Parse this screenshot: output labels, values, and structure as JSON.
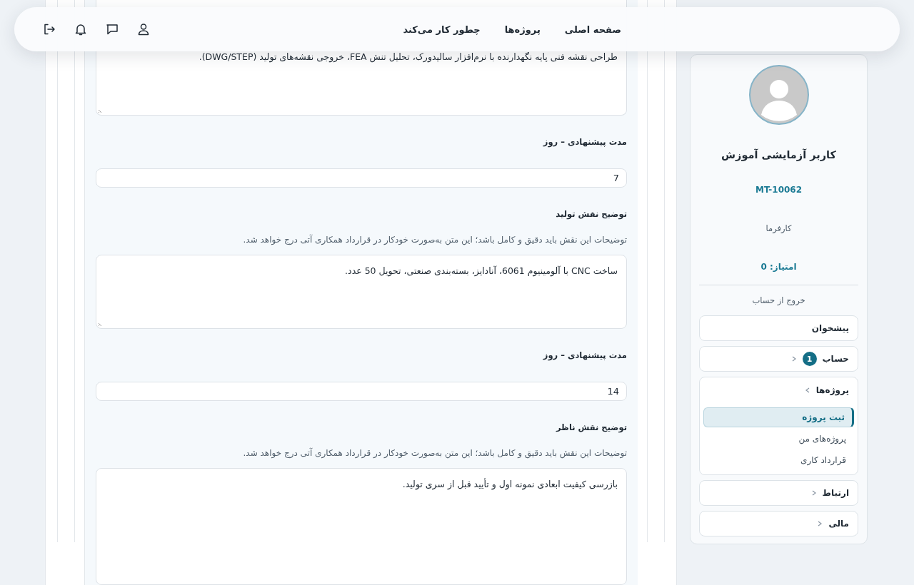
{
  "nav": {
    "links": [
      {
        "label": "صفحه اصلی"
      },
      {
        "label": "پروژه‌ها"
      },
      {
        "label": "چطور کار می‌کند"
      }
    ]
  },
  "form": [
    {
      "kind": "textarea",
      "value": "طراحی نقشه فنی پایه نگهدارنده با نرم‌افزار سالیدورک، تحلیل تنش FEA، خروجی نقشه‌های تولید (DWG/STEP)."
    },
    {
      "kind": "label",
      "text": "مدت پیشنهادی – روز"
    },
    {
      "kind": "input",
      "value": "7"
    },
    {
      "kind": "label",
      "text": "توضیح نقش تولید"
    },
    {
      "kind": "hint",
      "text": "توضیحات این نقش باید دقیق و کامل باشد؛ این متن به‌صورت خودکار در قرارداد همکاری آتی درج خواهد شد."
    },
    {
      "kind": "textarea",
      "value": "ساخت CNC با آلومینیوم 6061، آنادایز، بسته‌بندی صنعتی، تحویل 50 عدد."
    },
    {
      "kind": "label",
      "text": "مدت پیشنهادی – روز"
    },
    {
      "kind": "input",
      "value": "14"
    },
    {
      "kind": "label",
      "text": "توضیح نقش ناظر"
    },
    {
      "kind": "hint",
      "text": "توضیحات این نقش باید دقیق و کامل باشد؛ این متن به‌صورت خودکار در قرارداد همکاری آتی درج خواهد شد."
    },
    {
      "kind": "textarea",
      "value": "بازرسی کیفیت ابعادی نمونه اول و تأیید قبل از سری تولید."
    }
  ],
  "profile": {
    "name": "کاربر آزمایشی آموزش",
    "code": "MT-10062",
    "role": "کارفرما",
    "score": "امتیاز: 0",
    "logout": "خروج از حساب"
  },
  "menu": [
    {
      "label": "پیشخوان",
      "kind": "link"
    },
    {
      "label": "حساب",
      "kind": "group",
      "badge": "1",
      "expanded": false
    },
    {
      "label": "پروژه‌ها",
      "kind": "group",
      "expanded": true,
      "children": [
        {
          "label": "ثبت پروژه",
          "selected": true
        },
        {
          "label": "پروژه‌های من",
          "selected": false
        },
        {
          "label": "قرارداد کاری",
          "selected": false
        }
      ]
    },
    {
      "label": "ارتباط",
      "kind": "group",
      "expanded": false
    },
    {
      "label": "مالی",
      "kind": "group",
      "expanded": false
    }
  ]
}
